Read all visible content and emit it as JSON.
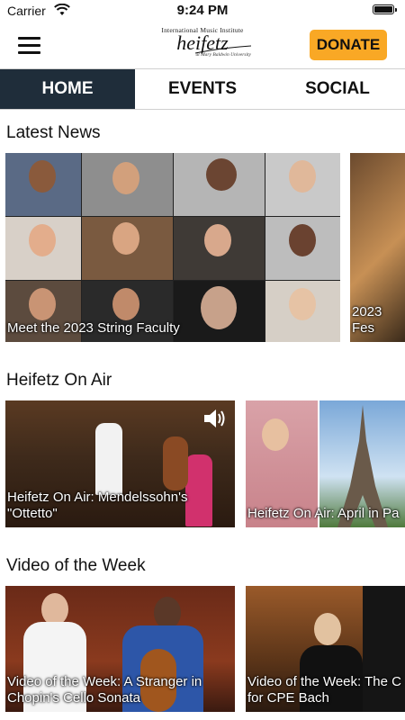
{
  "status_bar": {
    "carrier": "Carrier",
    "time": "9:24 PM"
  },
  "header": {
    "logo": {
      "line1": "International Music Institute",
      "line2": "heifetz",
      "line3": "at Mary Baldwin University"
    },
    "donate_label": "DONATE"
  },
  "tabs": [
    {
      "label": "HOME",
      "active": true
    },
    {
      "label": "EVENTS",
      "active": false
    },
    {
      "label": "SOCIAL",
      "active": false
    }
  ],
  "sections": {
    "latest_news": {
      "title": "Latest News",
      "cards": [
        {
          "caption": "Meet the 2023 String Faculty"
        },
        {
          "caption": "2023 Fes"
        }
      ]
    },
    "on_air": {
      "title": "Heifetz On Air",
      "cards": [
        {
          "caption": "Heifetz On Air: Mendelssohn's \"Ottetto\""
        },
        {
          "caption": "Heifetz On Air: April in Pa"
        }
      ]
    },
    "video_week": {
      "title": "Video of the Week",
      "cards": [
        {
          "caption": "Video of the Week: A Stranger in Chopin's Cello Sonata"
        },
        {
          "caption": "Video of the Week: The C for CPE Bach"
        }
      ]
    }
  },
  "colors": {
    "accent": "#f9a825",
    "tab_active_bg": "#1f2d3a"
  }
}
